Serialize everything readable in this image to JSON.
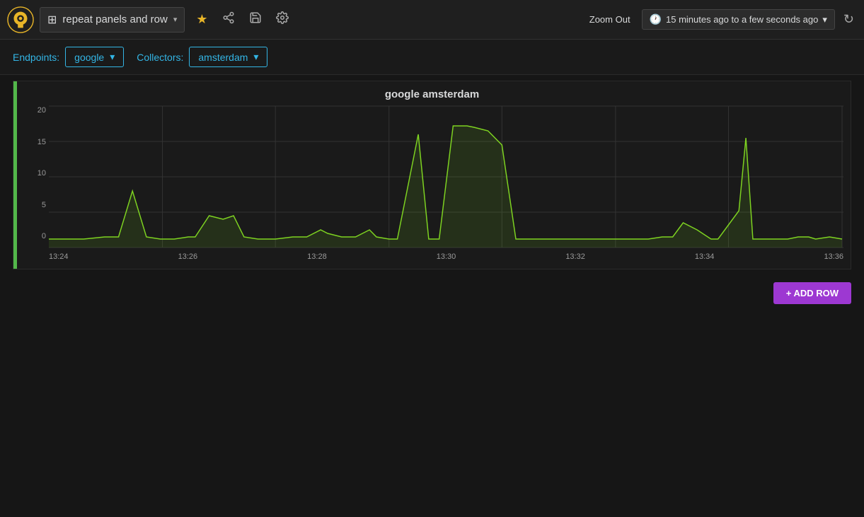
{
  "header": {
    "dashboard_title": "repeat panels and row",
    "chevron": "▾",
    "star_icon": "★",
    "share_icon": "⎋",
    "save_icon": "💾",
    "settings_icon": "⚙",
    "zoom_out_label": "Zoom Out",
    "time_range_label": "15 minutes ago to a few seconds ago",
    "refresh_icon": "↻"
  },
  "filters": {
    "endpoints_label": "Endpoints:",
    "endpoints_value": "google",
    "collectors_label": "Collectors:",
    "collectors_value": "amsterdam"
  },
  "chart": {
    "title": "google amsterdam",
    "y_labels": [
      "0",
      "5",
      "10",
      "15",
      "20"
    ],
    "x_labels": [
      "13:24",
      "13:26",
      "13:28",
      "13:30",
      "13:32",
      "13:34",
      "13:36"
    ]
  },
  "add_row": {
    "label": "+ ADD ROW"
  }
}
